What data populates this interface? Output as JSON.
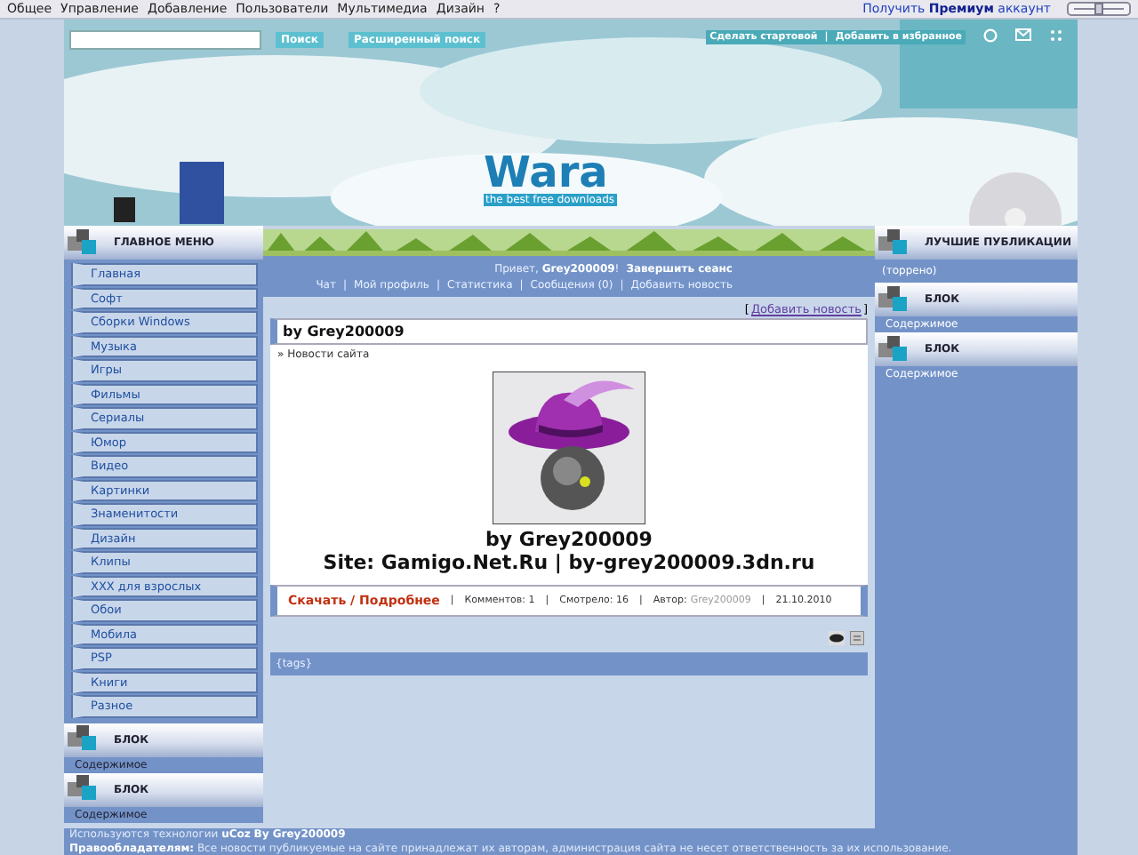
{
  "topbar": {
    "menu": [
      "Общее",
      "Управление",
      "Добавление",
      "Пользователи",
      "Мультимедиа",
      "Дизайн",
      "?"
    ],
    "premium": "Получить **Премиум** аккаунт"
  },
  "header": {
    "search_button": "Поиск",
    "advanced_button": "Расширенный поиск",
    "links": [
      "Сделать стартовой",
      "Добавить в избранное"
    ],
    "link_separator": "|",
    "logo": "Wara",
    "tagline": "the best free downloads"
  },
  "left": {
    "menu_title": "ГЛАВНОЕ МЕНЮ",
    "menu_items": [
      "Главная",
      "Софт",
      "Сборки Windows",
      "Музыка",
      "Игры",
      "Фильмы",
      "Сериалы",
      "Юмор",
      "Видео",
      "Картинки",
      "Знаменитости",
      "Дизайн",
      "Клипы",
      "XXX для взрослых",
      "Обои",
      "Мобила",
      "PSP",
      "Книги",
      "Разное"
    ],
    "blocks": [
      {
        "title": "БЛОК",
        "content": "Содержимое"
      },
      {
        "title": "БЛОК",
        "content": "Содержимое"
      }
    ]
  },
  "center": {
    "greeting": "Привет, **Grey200009**!",
    "logout": "Завершить сеанс",
    "separator": "|",
    "user_links": [
      "Чат",
      "Мой профиль",
      "Статистика",
      "Сообщения (0)",
      "Добавить новость"
    ],
    "add_news": {
      "open": "[",
      "label": "Добавить новость",
      "close": "]"
    },
    "post": {
      "title": "by Grey200009",
      "category": "» Новости сайта",
      "caption": [
        "by Grey200009",
        "Site: Gamigo.Net.Ru | by-grey200009.3dn.ru"
      ],
      "more": "Скачать / Подробнее",
      "meta": [
        "Комментов: 1",
        "Смотрело: 16"
      ],
      "author_label": "Автор:",
      "author": "Grey200009",
      "date": "21.10.2010"
    },
    "tags": "{tags}"
  },
  "right": {
    "title": "ЛУЧШИЕ ПУБЛИКАЦИИ",
    "top_content": "(торрено)",
    "blocks": [
      {
        "title": "БЛОК",
        "content": "Содержимое"
      },
      {
        "title": "БЛОК",
        "content": "Содержимое"
      }
    ]
  },
  "footer": [
    "Используются технологии **uCoz**  **By Grey200009**",
    "**Правообладателям:** Все новости публикуемые на сайте принадлежат их авторам, администрация сайта не несет ответственность за их использование."
  ]
}
